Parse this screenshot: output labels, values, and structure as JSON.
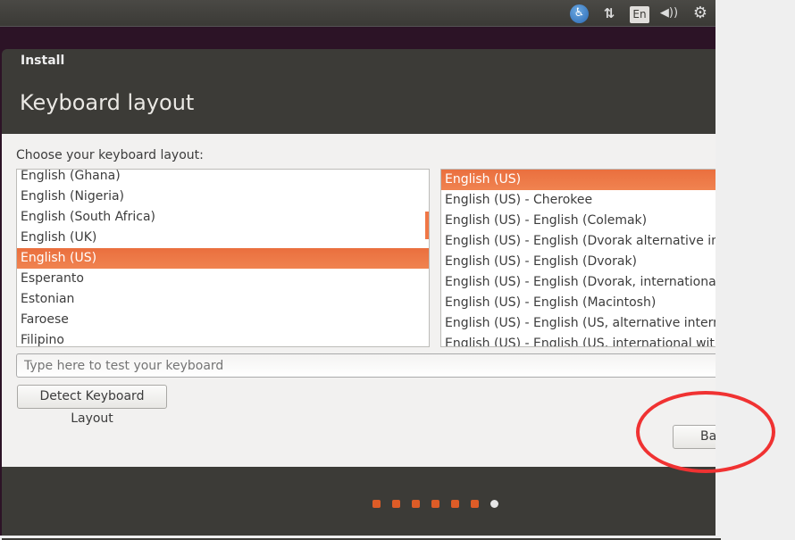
{
  "panel": {
    "icons": [
      "accessibility-icon",
      "network-icon",
      "keyboard-indicator",
      "volume-icon",
      "power-gear-icon"
    ],
    "keyboard_indicator": "En"
  },
  "window": {
    "title": "Install",
    "page_title": "Keyboard layout"
  },
  "prompt": "Choose your keyboard layout:",
  "layouts": [
    "English (Ghana)",
    "English (Nigeria)",
    "English (South Africa)",
    "English (UK)",
    "English (US)",
    "Esperanto",
    "Estonian",
    "Faroese",
    "Filipino"
  ],
  "layouts_selected": "English (US)",
  "variants": [
    "English (US)",
    "English (US) - Cherokee",
    "English (US) - English (Colemak)",
    "English (US) - English (Dvorak alternative international no dead keys)",
    "English (US) - English (Dvorak)",
    "English (US) - English (Dvorak, international with dead keys)",
    "English (US) - English (Macintosh)",
    "English (US) - English (US, alternative international)",
    "English (US) - English (US, international with dead keys)"
  ],
  "variants_selected": "English (US)",
  "test_input": {
    "value": "",
    "placeholder": "Type here to test your keyboard"
  },
  "detect_button": "Detect Keyboard Layout",
  "back_button": "Ba",
  "progress": {
    "total_steps": 7,
    "current_step": 7
  },
  "colors": {
    "accent": "#f07746",
    "annotation": "#f03232"
  }
}
